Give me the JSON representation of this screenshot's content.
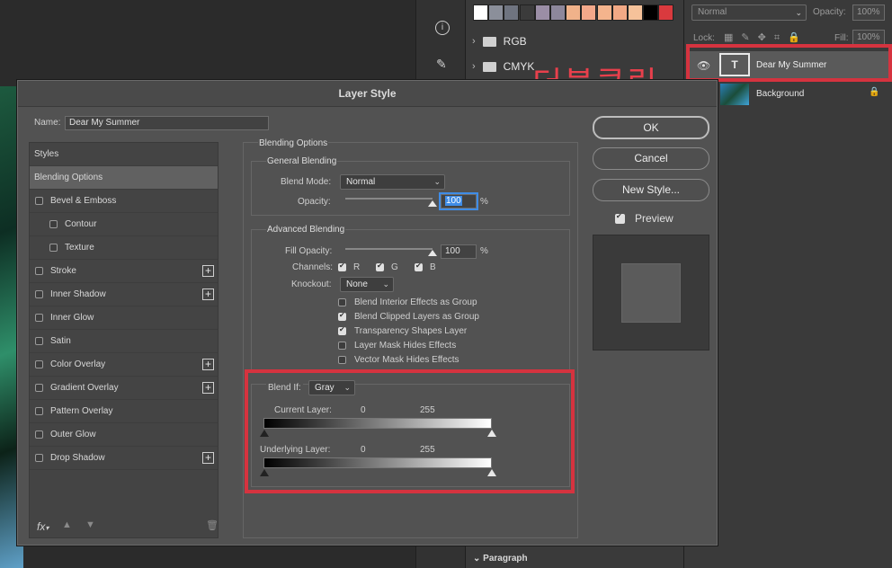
{
  "background": {
    "blend_mode": "Normal",
    "opacity_label": "Opacity:",
    "opacity_value": "100%",
    "lock_label": "Lock:",
    "fill_label": "Fill:",
    "fill_value": "100%",
    "folders": [
      "RGB",
      "CMYK"
    ],
    "swatches": [
      "#ffffff",
      "#8b8f9a",
      "#6f7480",
      "#3b3b3b",
      "#9b8ea6",
      "#8d879b",
      "#f0b28a",
      "#f3a88a",
      "#f4b48d",
      "#f2a985",
      "#f6c29a",
      "#000000",
      "#d93a3e"
    ],
    "layers": [
      {
        "name": "Dear My Summer",
        "thumb": "T"
      },
      {
        "name": "Background"
      }
    ],
    "paragraph_panel": "Paragraph",
    "annotation": "더블클릭"
  },
  "dialog": {
    "title": "Layer Style",
    "name_label": "Name:",
    "name_value": "Dear My Summer",
    "styles_header": "Styles",
    "styles": [
      {
        "label": "Blending Options",
        "selected": true,
        "checkbox": false,
        "plus": false,
        "indent": false
      },
      {
        "label": "Bevel & Emboss",
        "checkbox": true,
        "plus": false,
        "indent": false
      },
      {
        "label": "Contour",
        "checkbox": true,
        "plus": false,
        "indent": true
      },
      {
        "label": "Texture",
        "checkbox": true,
        "plus": false,
        "indent": true
      },
      {
        "label": "Stroke",
        "checkbox": true,
        "plus": true,
        "indent": false
      },
      {
        "label": "Inner Shadow",
        "checkbox": true,
        "plus": true,
        "indent": false
      },
      {
        "label": "Inner Glow",
        "checkbox": true,
        "plus": false,
        "indent": false
      },
      {
        "label": "Satin",
        "checkbox": true,
        "plus": false,
        "indent": false
      },
      {
        "label": "Color Overlay",
        "checkbox": true,
        "plus": true,
        "indent": false
      },
      {
        "label": "Gradient Overlay",
        "checkbox": true,
        "plus": true,
        "indent": false
      },
      {
        "label": "Pattern Overlay",
        "checkbox": true,
        "plus": false,
        "indent": false
      },
      {
        "label": "Outer Glow",
        "checkbox": true,
        "plus": false,
        "indent": false
      },
      {
        "label": "Drop Shadow",
        "checkbox": true,
        "plus": true,
        "indent": false
      }
    ],
    "fx_label": "fx",
    "blending_options_title": "Blending Options",
    "general_blending": "General Blending",
    "blend_mode_label": "Blend Mode:",
    "blend_mode_value": "Normal",
    "opacity_label": "Opacity:",
    "opacity_value": "100",
    "opacity_level": 1.0,
    "percent": "%",
    "advanced_blending": "Advanced Blending",
    "fill_opacity_label": "Fill Opacity:",
    "fill_opacity_value": "100",
    "fill_opacity_level": 1.0,
    "channels_label": "Channels:",
    "channels": [
      "R",
      "G",
      "B"
    ],
    "knockout_label": "Knockout:",
    "knockout_value": "None",
    "options": [
      {
        "label": "Blend Interior Effects as Group",
        "checked": false
      },
      {
        "label": "Blend Clipped Layers as Group",
        "checked": true
      },
      {
        "label": "Transparency Shapes Layer",
        "checked": true
      },
      {
        "label": "Layer Mask Hides Effects",
        "checked": false
      },
      {
        "label": "Vector Mask Hides Effects",
        "checked": false
      }
    ],
    "blend_if_label": "Blend If:",
    "blend_if_value": "Gray",
    "current_layer_label": "Current Layer:",
    "underlying_layer_label": "Underlying Layer:",
    "range_low": "0",
    "range_high": "255",
    "buttons": {
      "ok": "OK",
      "cancel": "Cancel",
      "new_style": "New Style..."
    },
    "preview_label": "Preview"
  }
}
